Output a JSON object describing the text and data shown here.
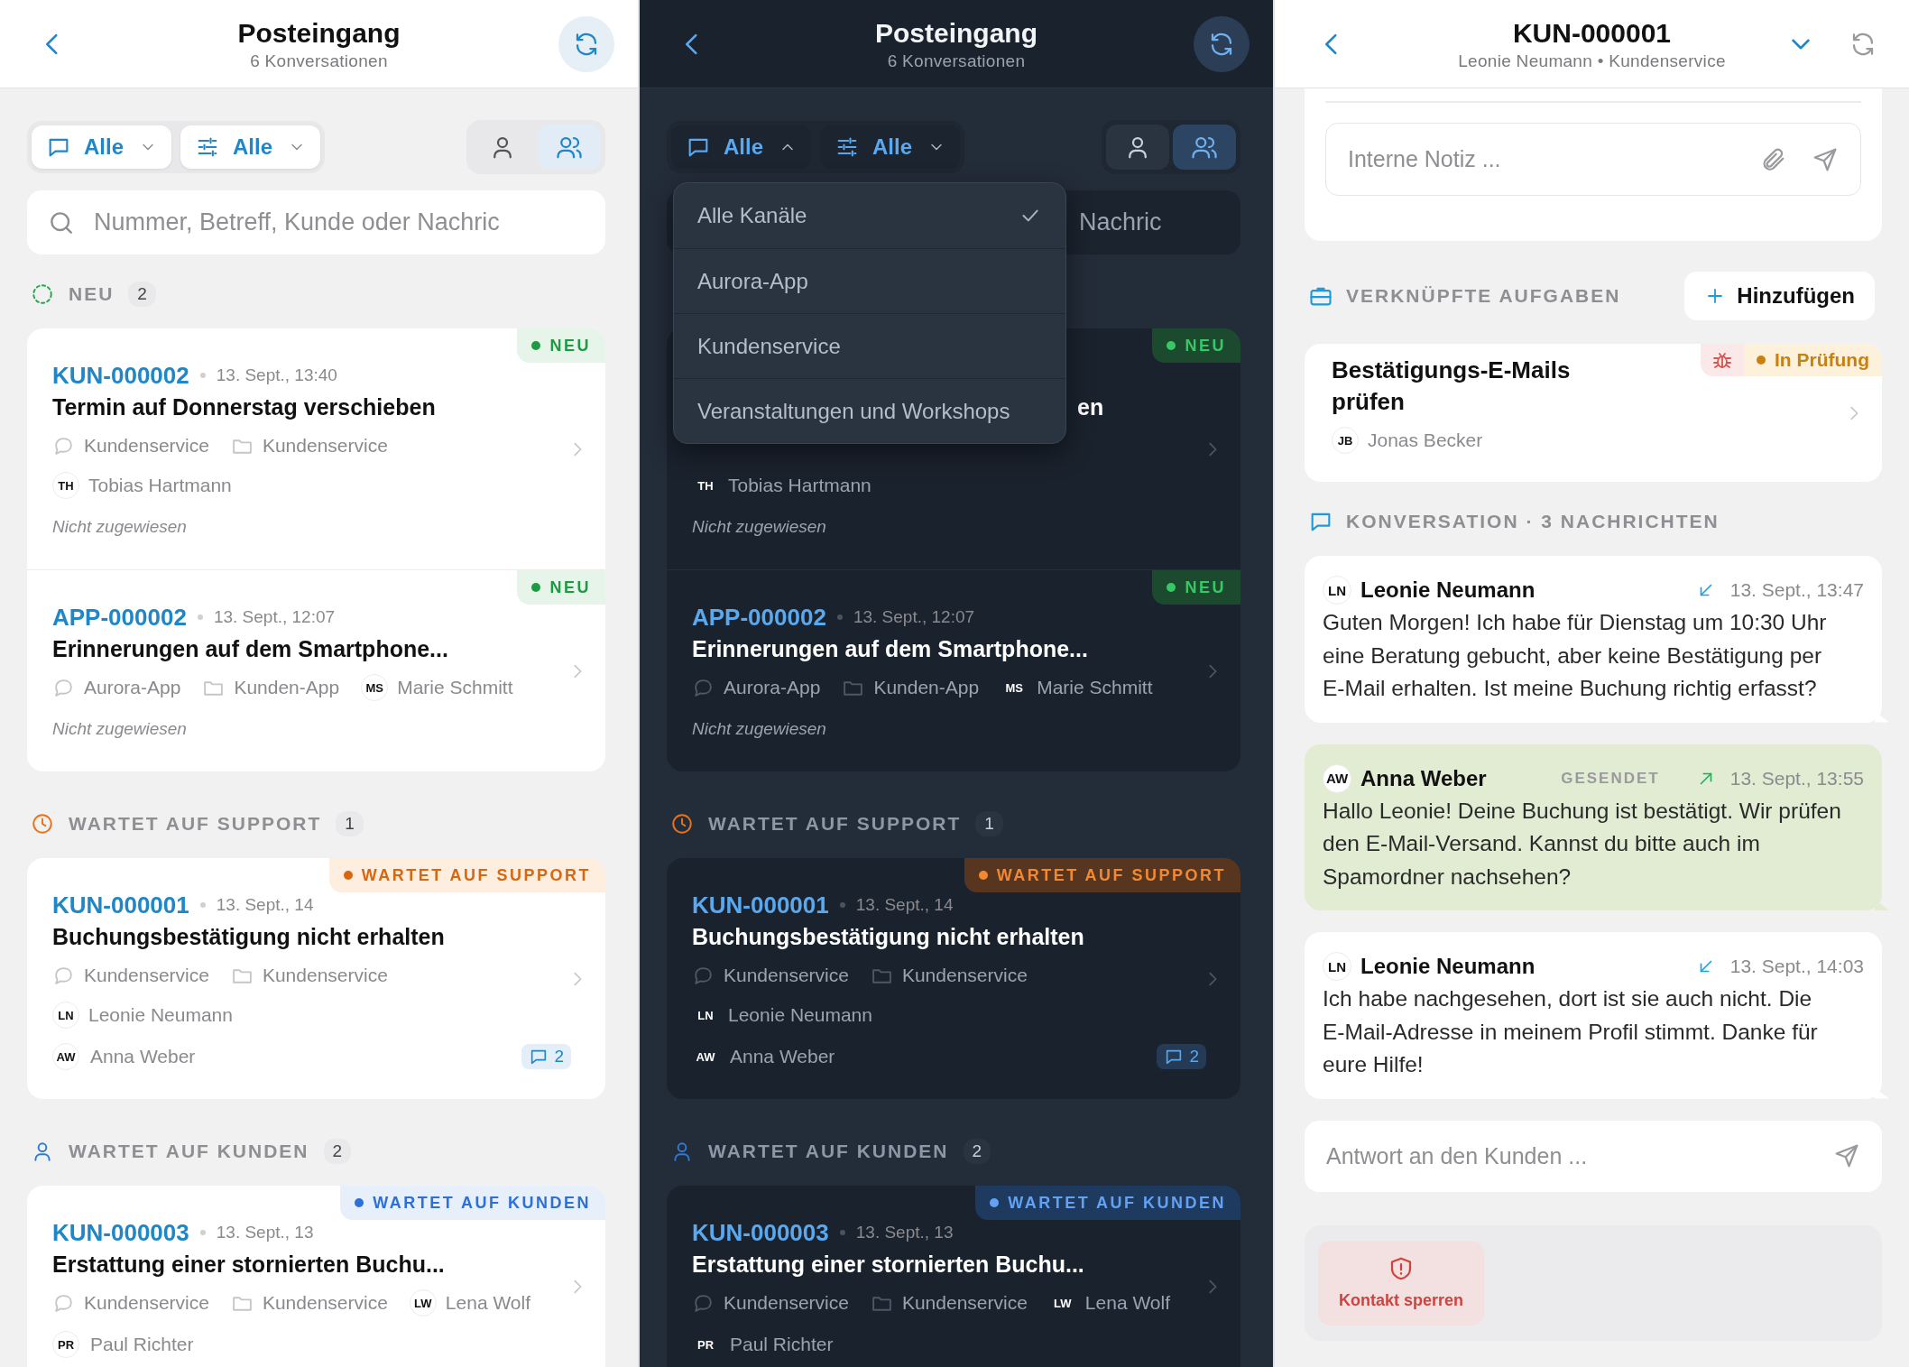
{
  "panels": [
    {
      "kind": "inbox",
      "dark_mode": false,
      "header": {
        "title": "Posteingang",
        "subtitle": "6 Konversationen"
      },
      "filters": [
        {
          "kind": "channel",
          "label": "Alle",
          "expanded": false
        },
        {
          "kind": "status",
          "label": "Alle",
          "expanded": false
        }
      ],
      "view_toggle": [
        {
          "kind": "single",
          "selected": false
        },
        {
          "kind": "team",
          "selected": true
        }
      ],
      "search": {
        "kind": "open",
        "placeholder": "Nummer, Betreff, Kunde oder Nachric"
      },
      "groups": [
        {
          "kind": "new",
          "label": "NEU",
          "count": "2",
          "cards": [
            {
              "kind": "ticket",
              "id": "KUN-000002",
              "time": "13. Sept., 13:40",
              "title": "Termin auf Donnerstag verschieben",
              "status": {
                "kind": "new",
                "label": "NEU"
              },
              "meta_rows": [
                {
                  "kind": "list",
                  "items": [
                    {
                      "kind": "channel",
                      "text": "Kundenservice"
                    },
                    {
                      "kind": "folder",
                      "text": "Kundenservice"
                    }
                  ]
                },
                {
                  "kind": "list",
                  "items": [
                    {
                      "kind": "person",
                      "initials": "TH",
                      "text": "Tobias Hartmann"
                    }
                  ]
                }
              ],
              "footer": {
                "kind": "note",
                "text": "Nicht zugewiesen"
              }
            },
            {
              "kind": "ticket",
              "id": "APP-000002",
              "time": "13. Sept., 12:07",
              "title": "Erinnerungen auf dem Smartphone...",
              "status": {
                "kind": "new",
                "label": "NEU"
              },
              "meta_rows": [
                {
                  "kind": "list",
                  "items": [
                    {
                      "kind": "channel",
                      "text": "Aurora-App"
                    },
                    {
                      "kind": "folder",
                      "text": "Kunden-App"
                    },
                    {
                      "kind": "person",
                      "initials": "MS",
                      "text": "Marie Schmitt"
                    }
                  ]
                }
              ],
              "footer": {
                "kind": "note",
                "text": "Nicht zugewiesen"
              }
            }
          ]
        },
        {
          "kind": "support",
          "label": "WARTET AUF SUPPORT",
          "count": "1",
          "cards": [
            {
              "kind": "ticket",
              "id": "KUN-000001",
              "time": "13. Sept., 14",
              "title": "Buchungsbestätigung nicht erhalten",
              "status": {
                "kind": "support",
                "label": "WARTET AUF SUPPORT"
              },
              "meta_rows": [
                {
                  "kind": "list",
                  "items": [
                    {
                      "kind": "channel",
                      "text": "Kundenservice"
                    },
                    {
                      "kind": "folder",
                      "text": "Kundenservice"
                    }
                  ]
                },
                {
                  "kind": "list",
                  "items": [
                    {
                      "kind": "person",
                      "initials": "LN",
                      "text": "Leonie Neumann"
                    }
                  ]
                }
              ],
              "footer": {
                "kind": "person",
                "initials": "AW",
                "text": "Anna Weber",
                "messages": "2"
              }
            }
          ]
        },
        {
          "kind": "customer",
          "label": "WARTET AUF KUNDEN",
          "count": "2",
          "cards": [
            {
              "kind": "ticket",
              "id": "KUN-000003",
              "time": "13. Sept., 13",
              "title": "Erstattung einer stornierten Buchu...",
              "status": {
                "kind": "customer",
                "label": "WARTET AUF KUNDEN"
              },
              "meta_rows": [
                {
                  "kind": "list",
                  "items": [
                    {
                      "kind": "channel",
                      "text": "Kundenservice"
                    },
                    {
                      "kind": "folder",
                      "text": "Kundenservice"
                    },
                    {
                      "kind": "person",
                      "initials": "LW",
                      "text": "Lena Wolf"
                    }
                  ]
                }
              ],
              "footer": {
                "kind": "person",
                "initials": "PR",
                "text": "Paul Richter"
              }
            }
          ]
        }
      ]
    },
    {
      "kind": "inbox",
      "dark_mode": true,
      "header": {
        "title": "Posteingang",
        "subtitle": "6 Konversationen"
      },
      "filters": [
        {
          "kind": "channel",
          "label": "Alle",
          "expanded": true
        },
        {
          "kind": "status",
          "label": "Alle",
          "expanded": false
        }
      ],
      "view_toggle": [
        {
          "kind": "single",
          "selected": false
        },
        {
          "kind": "team",
          "selected": true
        }
      ],
      "search": {
        "kind": "covered",
        "placeholder": "Nachric"
      },
      "menu": {
        "items": [
          {
            "label": "Alle Kanäle",
            "selected": true
          },
          {
            "label": "Aurora-App",
            "selected": false
          },
          {
            "label": "Kundenservice",
            "selected": false
          },
          {
            "label": "Veranstaltungen und Workshops",
            "selected": false
          }
        ]
      },
      "groups": [
        {
          "kind": "new",
          "cards": [
            {
              "kind": "covered",
              "title": "en",
              "status": {
                "kind": "new",
                "label": "NEU"
              },
              "meta_rows": [
                {
                  "kind": "covered"
                },
                {
                  "kind": "list",
                  "items": [
                    {
                      "kind": "person",
                      "initials": "TH",
                      "text": "Tobias Hartmann"
                    }
                  ]
                }
              ],
              "footer": {
                "kind": "note",
                "text": "Nicht zugewiesen"
              }
            },
            {
              "kind": "ticket",
              "id": "APP-000002",
              "time": "13. Sept., 12:07",
              "title": "Erinnerungen auf dem Smartphone...",
              "status": {
                "kind": "new",
                "label": "NEU"
              },
              "meta_rows": [
                {
                  "kind": "list",
                  "items": [
                    {
                      "kind": "channel",
                      "text": "Aurora-App"
                    },
                    {
                      "kind": "folder",
                      "text": "Kunden-App"
                    },
                    {
                      "kind": "person",
                      "initials": "MS",
                      "text": "Marie Schmitt"
                    }
                  ]
                }
              ],
              "footer": {
                "kind": "note",
                "text": "Nicht zugewiesen"
              }
            }
          ]
        },
        {
          "kind": "support",
          "label": "WARTET AUF SUPPORT",
          "count": "1",
          "cards": [
            {
              "kind": "ticket",
              "id": "KUN-000001",
              "time": "13. Sept., 14",
              "title": "Buchungsbestätigung nicht erhalten",
              "status": {
                "kind": "support",
                "label": "WARTET AUF SUPPORT"
              },
              "meta_rows": [
                {
                  "kind": "list",
                  "items": [
                    {
                      "kind": "channel",
                      "text": "Kundenservice"
                    },
                    {
                      "kind": "folder",
                      "text": "Kundenservice"
                    }
                  ]
                },
                {
                  "kind": "list",
                  "items": [
                    {
                      "kind": "person",
                      "initials": "LN",
                      "text": "Leonie Neumann"
                    }
                  ]
                }
              ],
              "footer": {
                "kind": "person",
                "initials": "AW",
                "text": "Anna Weber",
                "messages": "2"
              }
            }
          ]
        },
        {
          "kind": "customer",
          "label": "WARTET AUF KUNDEN",
          "count": "2",
          "cards": [
            {
              "kind": "ticket",
              "id": "KUN-000003",
              "time": "13. Sept., 13",
              "title": "Erstattung einer stornierten Buchu...",
              "status": {
                "kind": "customer",
                "label": "WARTET AUF KUNDEN"
              },
              "meta_rows": [
                {
                  "kind": "list",
                  "items": [
                    {
                      "kind": "channel",
                      "text": "Kundenservice"
                    },
                    {
                      "kind": "folder",
                      "text": "Kundenservice"
                    },
                    {
                      "kind": "person",
                      "initials": "LW",
                      "text": "Lena Wolf"
                    }
                  ]
                }
              ],
              "footer": {
                "kind": "person",
                "initials": "PR",
                "text": "Paul Richter"
              }
            }
          ]
        }
      ]
    },
    {
      "kind": "detail",
      "dark_mode": false,
      "header": {
        "title": "KUN-000001",
        "subtitle": "Leonie Neumann • Kundenservice"
      },
      "note": {
        "placeholder": "Interne Notiz ..."
      },
      "tasks": {
        "label": "VERKNÜPFTE AUFGABEN",
        "add_label": "Hinzufügen",
        "items": [
          {
            "title": "Bestätigungs-E-Mails prüfen",
            "kind": "bug",
            "status": {
              "kind": "review",
              "label": "In Prüfung"
            },
            "assignee": {
              "initials": "JB",
              "name": "Jonas Becker"
            }
          }
        ]
      },
      "conversation": {
        "label": "KONVERSATION · 3 NACHRICHTEN",
        "messages": [
          {
            "kind": "incoming",
            "initials": "LN",
            "sender": "Leonie Neumann",
            "time": "13. Sept., 13:47",
            "text": "Guten Morgen! Ich habe für Dienstag um 10:30 Uhr eine Beratung gebucht, aber keine Bestätigung per E-Mail erhalten. Ist meine Buchung richtig erfasst?"
          },
          {
            "kind": "outgoing",
            "initials": "AW",
            "sender": "Anna Weber",
            "state": "GESENDET",
            "time": "13. Sept., 13:55",
            "text": "Hallo Leonie! Deine Buchung ist bestätigt. Wir prüfen den E-Mail-Versand. Kannst du bitte auch im Spamordner nachsehen?"
          },
          {
            "kind": "incoming",
            "initials": "LN",
            "sender": "Leonie Neumann",
            "time": "13. Sept., 14:03",
            "text": "Ich habe nachgesehen, dort ist sie auch nicht. Die E-Mail-Adresse in meinem Profil stimmt. Danke für eure Hilfe!"
          }
        ]
      },
      "reply": {
        "placeholder": "Antwort an den Kunden ..."
      },
      "actions": [
        {
          "kind": "block",
          "label": "Kontakt sperren"
        }
      ]
    }
  ]
}
